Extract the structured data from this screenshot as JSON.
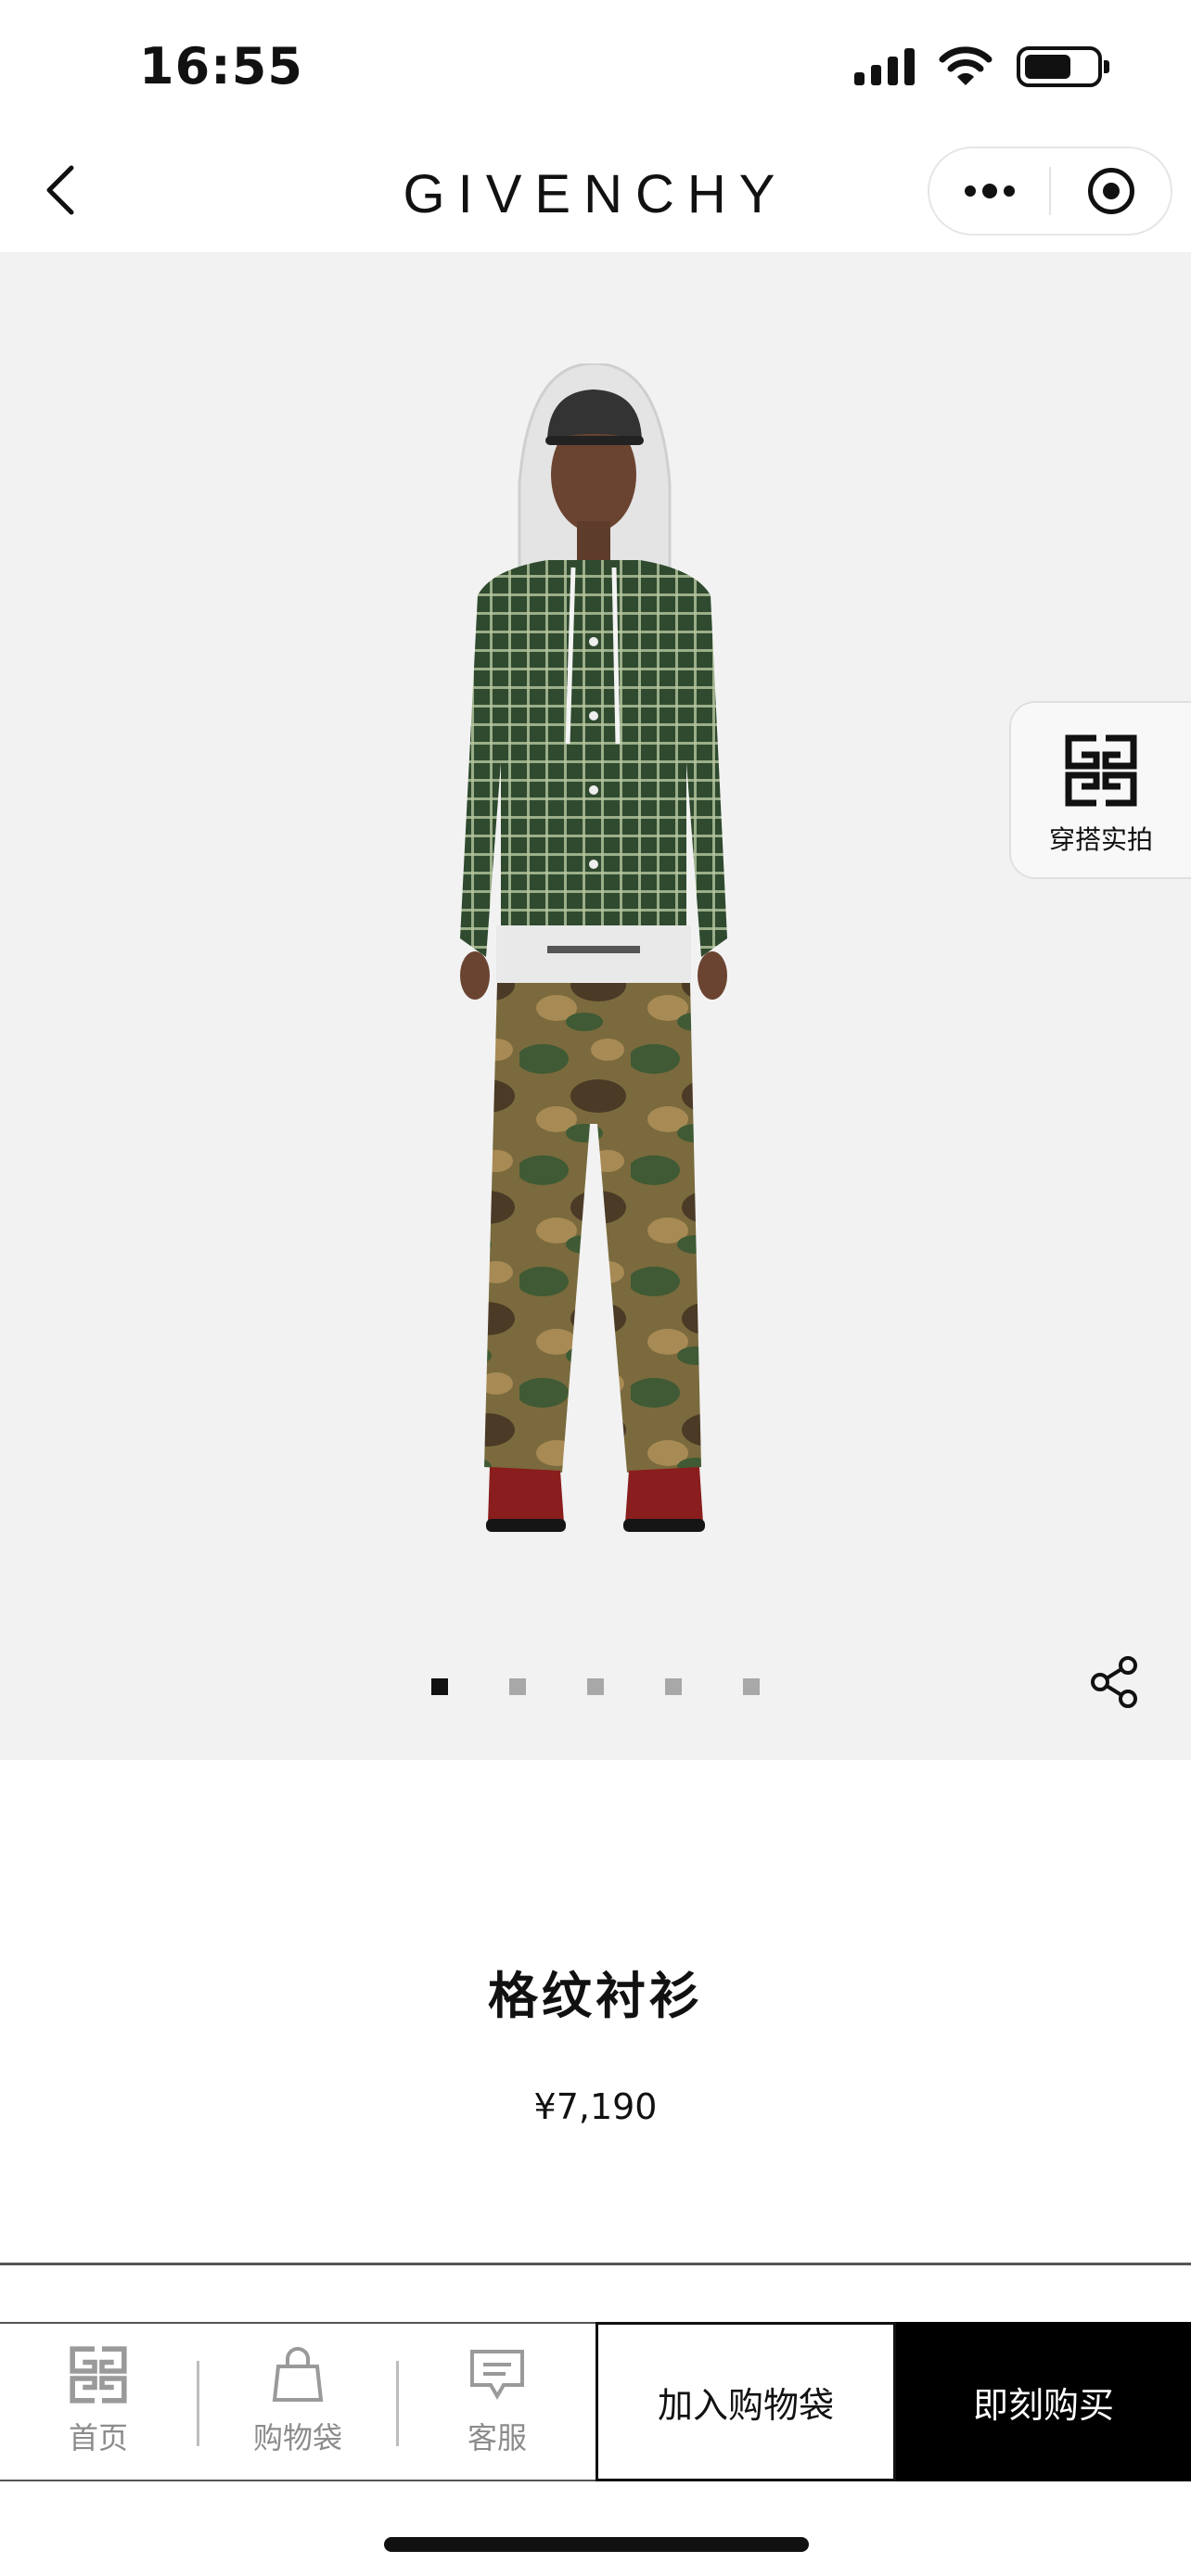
{
  "status_bar": {
    "time": "16:55"
  },
  "nav": {
    "brand": "GIVENCHY"
  },
  "gallery": {
    "page_count": 5,
    "active_page": 1,
    "outfit_label": "穿搭实拍"
  },
  "product": {
    "title": "格纹衬衫",
    "price": "¥7,190"
  },
  "bottom_bar": {
    "tabs": [
      {
        "label": "首页",
        "icon": "givenchy-logo-icon"
      },
      {
        "label": "购物袋",
        "icon": "shopping-bag-icon"
      },
      {
        "label": "客服",
        "icon": "chat-icon"
      }
    ],
    "add_to_cart_label": "加入购物袋",
    "buy_now_label": "即刻购买"
  },
  "colors": {
    "accent": "#000000",
    "gallery_bg": "#f2f2f2",
    "tab_gray": "#8c8c8c"
  }
}
